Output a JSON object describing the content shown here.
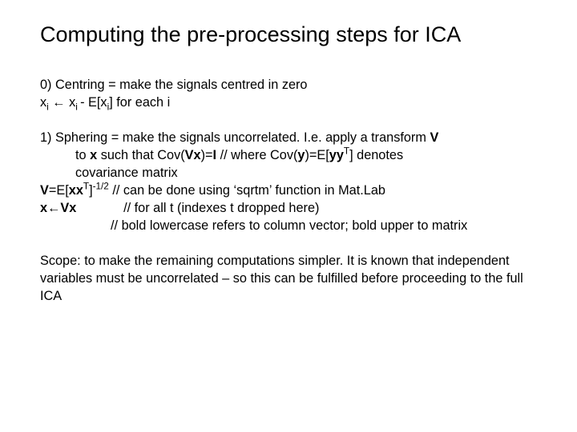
{
  "title": "Computing the pre-processing steps for ICA",
  "step0_line1": "0) Centring = make the signals centred in zero",
  "step0_line2_pre": "x",
  "step0_sub_i1": "i",
  "step0_arrow": " ← x",
  "step0_sub_i2": "i ",
  "step0_mid": "- E[x",
  "step0_sub_i3": "i",
  "step0_tail": "] for each i",
  "s1_a": "1) Sphering = make the signals uncorrelated. I.e. apply a transform ",
  "s1_V": "V",
  "s1_b": "to ",
  "s1_x": "x",
  "s1_c": " such that Cov(",
  "s1_Vx": "Vx",
  "s1_d": ")=",
  "s1_I": "I",
  "s1_e": "   // where Cov(",
  "s1_y": "y",
  "s1_f": ")=E[",
  "s1_yy": "yy",
  "s1_T1": "T",
  "s1_g": "] denotes",
  "s1_h": "covariance matrix",
  "s1_V2": "V",
  "s1_eq": "=E[",
  "s1_xx": "xx",
  "s1_T2": "T",
  "s1_close": "]",
  "s1_pow": "-1/2",
  "s1_i": "   // can be done using ‘sqrtm’ function in Mat.Lab",
  "s1_x2": "x",
  "s1_arrow2": "←",
  "s1_Vx2": "Vx",
  "s1_j": "             // for all t (indexes t dropped here)",
  "s1_k": "// bold lowercase refers to column vector; bold upper to matrix",
  "scope": "Scope: to make the remaining computations simpler. It is known that independent variables must be uncorrelated – so this can be fulfilled before proceeding to the full ICA"
}
